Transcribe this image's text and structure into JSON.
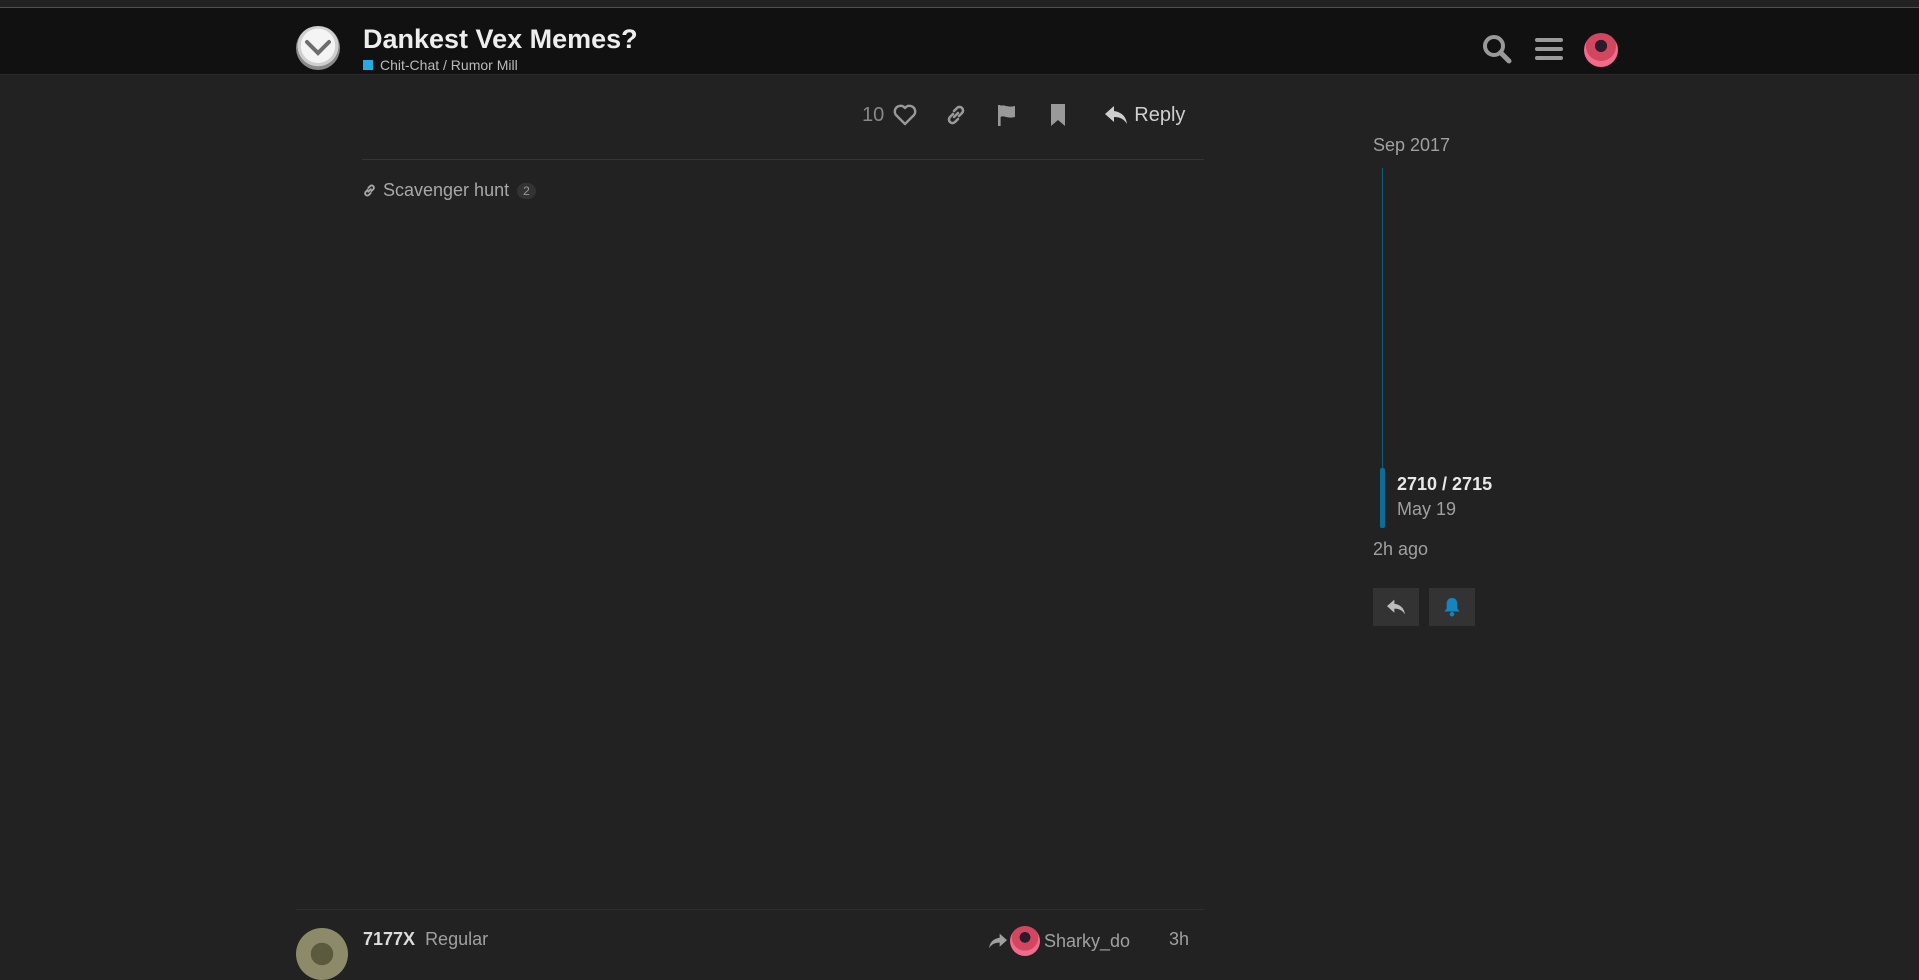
{
  "header": {
    "title": "Dankest Vex Memes?",
    "category": "Chit-Chat / Rumor Mill",
    "category_color": "#25aae1",
    "accent_line_color": "#b0156f",
    "icons": [
      "search-icon",
      "hamburger-menu-icon",
      "user-avatar"
    ]
  },
  "post_actions": {
    "like_count": "10",
    "reply_label": "Reply",
    "icons": [
      "heart-icon",
      "link-icon",
      "flag-icon",
      "bookmark-icon",
      "reply-icon"
    ]
  },
  "linked_topics": [
    {
      "title": "Scavenger hunt",
      "count": "2"
    }
  ],
  "timeline": {
    "start_label": "Sep 2017",
    "position": "2710 / 2715",
    "position_date": "May 19",
    "end_label": "2h ago",
    "accent_color": "#0d6d96"
  },
  "next_post": {
    "username": "7177X",
    "user_title": "Regular",
    "reply_to": "Sharky_do",
    "time": "3h"
  }
}
